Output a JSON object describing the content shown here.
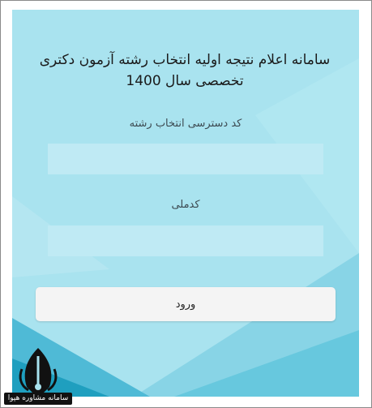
{
  "page": {
    "title": "سامانه اعلام نتیجه اولیه انتخاب رشته آزمون دکتری تخصصی سال 1400"
  },
  "form": {
    "access_code_label": "کد دسترسی انتخاب رشته",
    "access_code_value": "",
    "national_code_label": "کدملی",
    "national_code_value": "",
    "submit_label": "ورود"
  },
  "watermark": {
    "text": "سامانه مشاوره هپوا",
    "icon": "pen-nib-icon"
  },
  "colors": {
    "panel_bg": "#a9e3ef",
    "field_bg": "#bfeaf4",
    "button_bg": "#f4f4f4",
    "accent_dark": "#1f9fbf"
  }
}
